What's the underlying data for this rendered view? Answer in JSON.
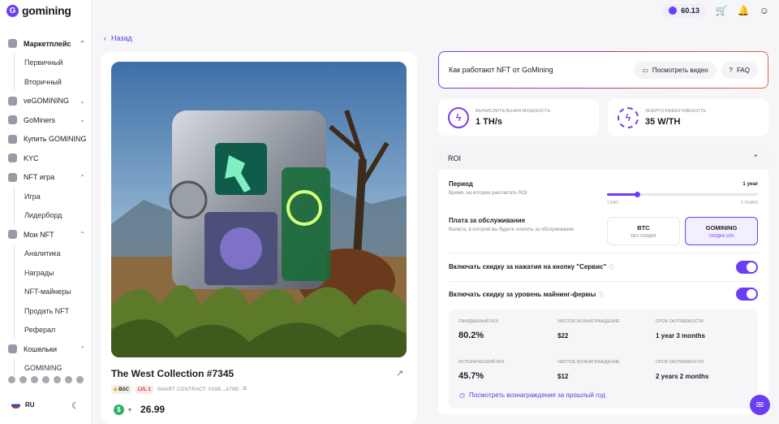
{
  "brand": {
    "name": "gomining"
  },
  "topbar": {
    "balance": "60.13"
  },
  "sidebar": {
    "items": [
      {
        "label": "Маркетплейс",
        "type": "group",
        "chevron": "up"
      },
      {
        "label": "Первичный",
        "type": "sub"
      },
      {
        "label": "Вторичный",
        "type": "sub"
      },
      {
        "label": "veGOMINING",
        "type": "group",
        "chevron": "down"
      },
      {
        "label": "GoMiners",
        "type": "group",
        "chevron": "down"
      },
      {
        "label": "Купить GOMINING",
        "type": "item"
      },
      {
        "label": "KYC",
        "type": "item"
      },
      {
        "label": "NFT игра",
        "type": "group",
        "chevron": "up"
      },
      {
        "label": "Игра",
        "type": "sub"
      },
      {
        "label": "Лидерборд",
        "type": "sub"
      },
      {
        "label": "Мои NFT",
        "type": "group",
        "chevron": "up"
      },
      {
        "label": "Аналитика",
        "type": "sub"
      },
      {
        "label": "Награды",
        "type": "sub"
      },
      {
        "label": "NFT-майнеры",
        "type": "sub"
      },
      {
        "label": "Продать NFT",
        "type": "sub"
      },
      {
        "label": "Реферал",
        "type": "sub"
      },
      {
        "label": "Кошельки",
        "type": "group",
        "chevron": "up"
      },
      {
        "label": "GOMINING",
        "type": "sub"
      }
    ],
    "language": "RU"
  },
  "back_label": "Назад",
  "nft": {
    "title": "The West Collection #7345",
    "chain_tag": "BSC",
    "level_tag": "LVL 1",
    "contract": "SMART CONTRACT: 0X86...A79D",
    "price": "26.99"
  },
  "how": {
    "title": "Как работают NFT от GoMining",
    "video_label": "Посмотреть видео",
    "faq_label": "FAQ"
  },
  "stats": {
    "power_label": "ВЫЧИСЛИТЕЛЬНАЯ МОЩНОСТЬ",
    "power_value": "1 TH/s",
    "efficiency_label": "ЭНЕРГОЭФФЕКТИВНОСТЬ",
    "efficiency_value": "35 W/TH"
  },
  "roi": {
    "header": "ROI",
    "period_label": "Период",
    "period_sub": "Время, на которое рассчитать ROI",
    "period_value": "1 year",
    "period_fraction": 0.2,
    "slider_min": "1 DAY",
    "slider_max": "5 YEARS",
    "fee_label": "Плата за обслуживание",
    "fee_sub": "Валюта, в которой вы будете платить за обслуживание",
    "fee_options": [
      {
        "name": "BTC",
        "sub": "БЕЗ СКИДКИ",
        "selected": false
      },
      {
        "name": "GOMINING",
        "sub": "СКИДКА 10%",
        "selected": true
      }
    ],
    "toggle_service": "Включать скидку за нажатия на кнопку \"Сервис\"",
    "toggle_farm": "Включать скидку за уровень майнинг-фермы",
    "results": {
      "expected_roi_label": "ОЖИДАЕМЫЙ ROI",
      "expected_roi": "80.2%",
      "net_reward_label": "ЧИСТОЕ ВОЗНАГРАЖДЕНИЕ",
      "net_reward": "$22",
      "payback_label": "СРОК ОКУПАЕМОСТИ",
      "payback": "1 year 3 months",
      "hist_roi_label": "ИСТОРИЧЕСКИЙ ROI",
      "hist_roi": "45.7%",
      "hist_net_reward_label": "ЧИСТОЕ ВОЗНАГРАЖДЕНИЕ",
      "hist_net_reward": "$12",
      "hist_payback_label": "СРОК ОКУПАЕМОСТИ",
      "hist_payback": "2 years 2 months",
      "past_link": "Посмотреть вознаграждения за прошлый год"
    }
  },
  "colors": {
    "accent": "#6b3df5",
    "success": "#29b36a"
  }
}
